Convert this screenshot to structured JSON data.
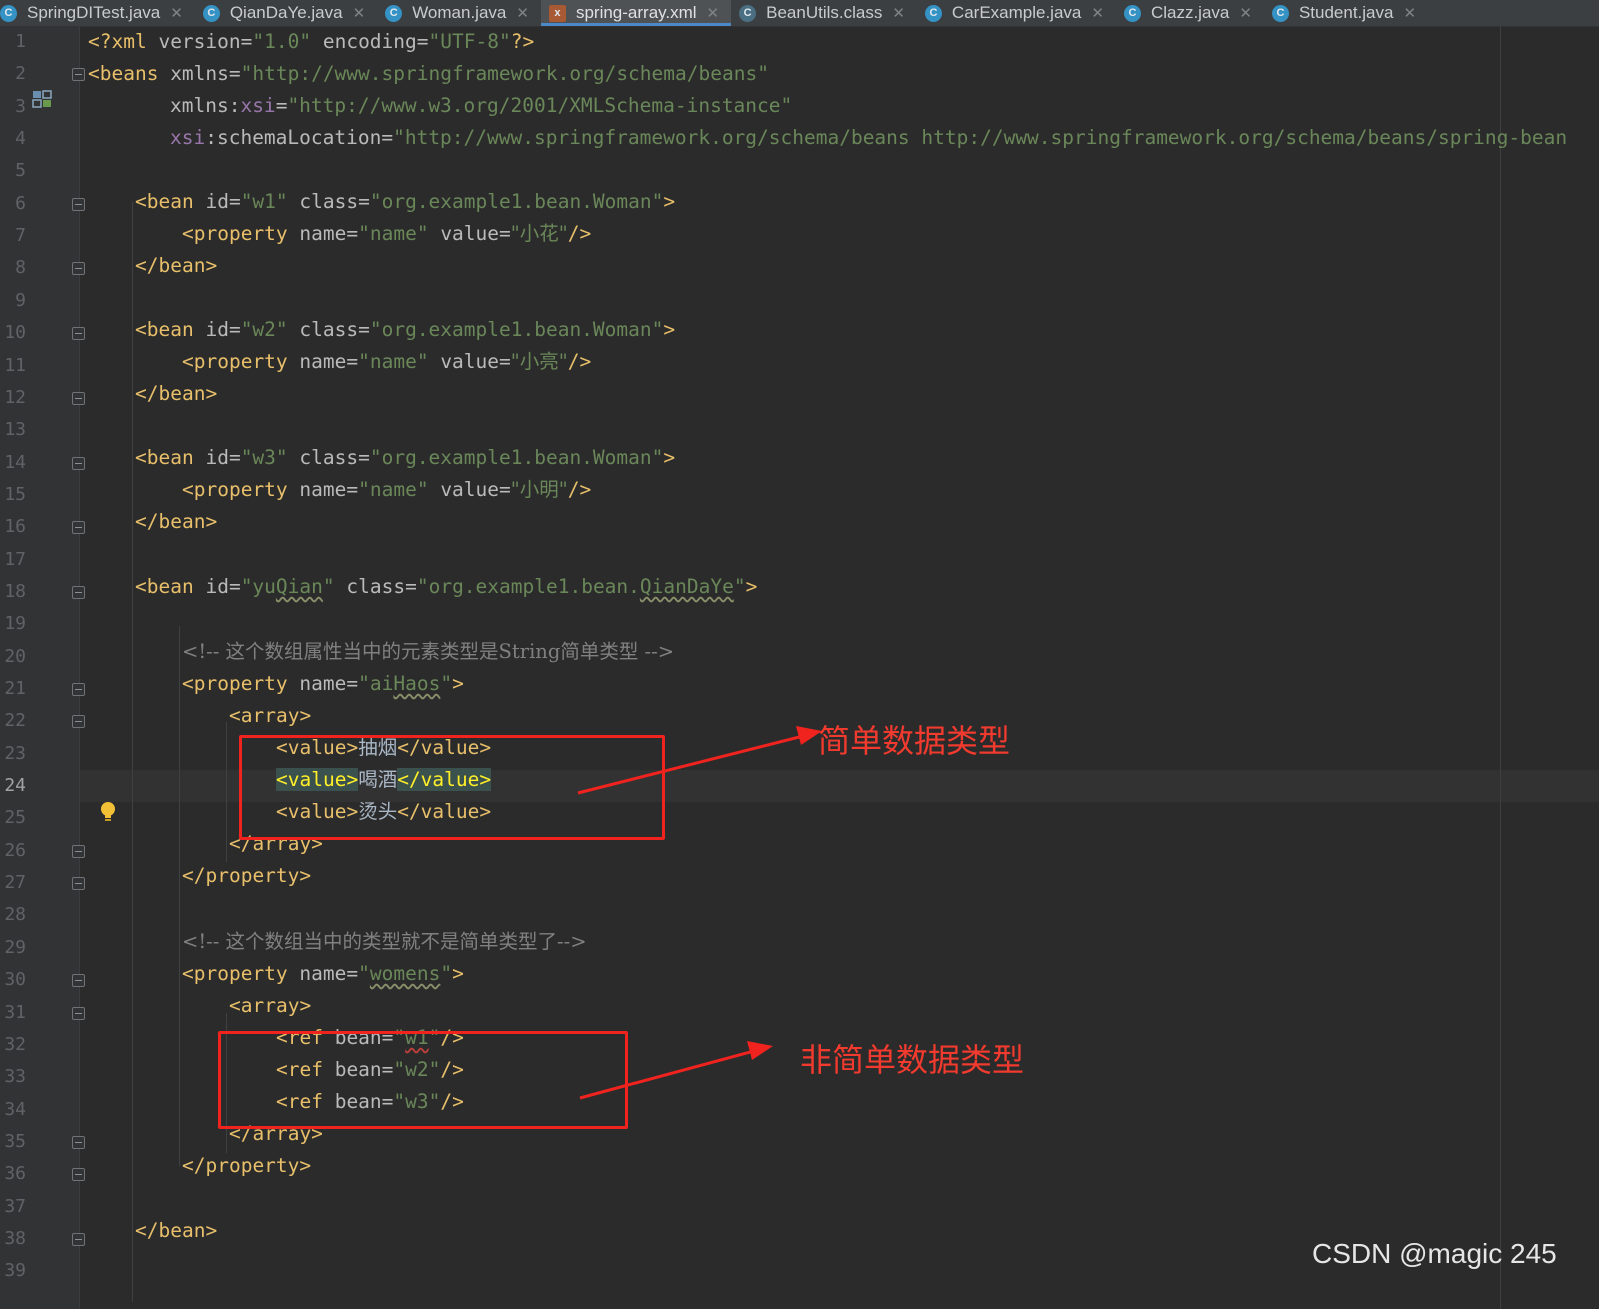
{
  "tabs": [
    {
      "label": "SpringDITest.java",
      "icon": "java-class-icon"
    },
    {
      "label": "QianDaYe.java",
      "icon": "java-class-icon"
    },
    {
      "label": "Woman.java",
      "icon": "java-class-icon"
    },
    {
      "label": "spring-array.xml",
      "icon": "xml-file-icon",
      "active": true
    },
    {
      "label": "BeanUtils.class",
      "icon": "compiled-class-icon"
    },
    {
      "label": "CarExample.java",
      "icon": "java-class-icon"
    },
    {
      "label": "Clazz.java",
      "icon": "java-class-icon"
    },
    {
      "label": "Student.java",
      "icon": "java-class-icon"
    }
  ],
  "editor": {
    "current_line": 24,
    "line_numbers": [
      "1",
      "2",
      "3",
      "4",
      "5",
      "6",
      "7",
      "8",
      "9",
      "10",
      "11",
      "12",
      "13",
      "14",
      "15",
      "16",
      "17",
      "18",
      "19",
      "20",
      "21",
      "22",
      "23",
      "24",
      "25",
      "26",
      "27",
      "28",
      "29",
      "30",
      "31",
      "32",
      "33",
      "34",
      "35",
      "36",
      "37",
      "38",
      "39"
    ],
    "code": {
      "l1": {
        "a": "<?xml ",
        "b": "version",
        "c": "=",
        "d": "\"1.0\"",
        "e": " ",
        "f": "encoding",
        "g": "=",
        "h": "\"UTF-8\"",
        "i": "?>"
      },
      "l2": {
        "a": "<beans ",
        "b": "xmlns",
        "c": "=",
        "d": "\"http://www.springframework.org/schema/beans\""
      },
      "l3": {
        "a": "xmlns:",
        "b": "xsi",
        "c": "=",
        "d": "\"http://www.w3.org/2001/XMLSchema-instance\""
      },
      "l4": {
        "a": "xsi",
        "b": ":schemaLocation",
        "c": "=",
        "d": "\"http://www.springframework.org/schema/beans http://www.springframework.org/schema/beans/spring-bean"
      },
      "l6": {
        "a": "<bean ",
        "b": "id",
        "c": "=",
        "d": "\"w1\"",
        "e": " class",
        "f": "=",
        "g": "\"org.example1.bean.Woman\"",
        "h": ">"
      },
      "l7": {
        "a": "<property ",
        "b": "name",
        "c": "=",
        "d": "\"name\"",
        "e": " value",
        "f": "=",
        "g": "\"小花\"",
        "h": "/>"
      },
      "l8": {
        "a": "</bean>"
      },
      "l10": {
        "a": "<bean ",
        "b": "id",
        "c": "=",
        "d": "\"w2\"",
        "e": " class",
        "f": "=",
        "g": "\"org.example1.bean.Woman\"",
        "h": ">"
      },
      "l11": {
        "a": "<property ",
        "b": "name",
        "c": "=",
        "d": "\"name\"",
        "e": " value",
        "f": "=",
        "g": "\"小亮\"",
        "h": "/>"
      },
      "l12": {
        "a": "</bean>"
      },
      "l14": {
        "a": "<bean ",
        "b": "id",
        "c": "=",
        "d": "\"w3\"",
        "e": " class",
        "f": "=",
        "g": "\"org.example1.bean.Woman\"",
        "h": ">"
      },
      "l15": {
        "a": "<property ",
        "b": "name",
        "c": "=",
        "d": "\"name\"",
        "e": " value",
        "f": "=",
        "g": "\"小明\"",
        "h": "/>"
      },
      "l16": {
        "a": "</bean>"
      },
      "l18": {
        "a": "<bean ",
        "b": "id",
        "c": "=",
        "d1": "\"yu",
        "d2": "Qian",
        "d3": "\"",
        "e": " class",
        "f": "=",
        "g1": "\"org.example1.bean.",
        "g2": "QianDaYe",
        "g3": "\"",
        "h": ">"
      },
      "l20": {
        "a": "<!-- 这个数组属性当中的元素类型是String简单类型 -->"
      },
      "l21": {
        "a": "<property ",
        "b": "name",
        "c": "=",
        "d1": "\"ai",
        "d2": "Haos",
        "d3": "\"",
        "h": ">"
      },
      "l22": {
        "a": "<array>"
      },
      "l23": {
        "a": "<value>",
        "b": "抽烟",
        "c": "</value>"
      },
      "l24": {
        "a": "<value>",
        "b": "喝酒",
        "c": "</value>"
      },
      "l25": {
        "a": "<value>",
        "b": "烫头",
        "c": "</value>"
      },
      "l26": {
        "a": "</array>"
      },
      "l27": {
        "a": "</property>"
      },
      "l29": {
        "a": "<!-- 这个数组当中的类型就不是简单类型了-->"
      },
      "l30": {
        "a": "<property ",
        "b": "name",
        "c": "=",
        "d1": "\"",
        "d2": "womens",
        "d3": "\"",
        "h": ">"
      },
      "l31": {
        "a": "<array>"
      },
      "l32": {
        "a": "<ref ",
        "b": "bean",
        "c": "=",
        "d1": "\"",
        "d2": "w1",
        "d3": "\"",
        "h": "/>"
      },
      "l33": {
        "a": "<ref ",
        "b": "bean",
        "c": "=",
        "d": "\"w2\"",
        "h": "/>"
      },
      "l34": {
        "a": "<ref ",
        "b": "bean",
        "c": "=",
        "d": "\"w3\"",
        "h": "/>"
      },
      "l35": {
        "a": "</array>"
      },
      "l36": {
        "a": "</property>"
      },
      "l38": {
        "a": "</bean>"
      }
    }
  },
  "annotations": {
    "simple_label": "简单数据类型",
    "non_simple_label": "非简单数据类型",
    "color": "#f0231f"
  },
  "watermark": "CSDN @magic 245",
  "colors": {
    "background": "#2b2b2b",
    "tag": "#e8bf6a",
    "string": "#6a8759",
    "attribute": "#bababa",
    "comment": "#808080",
    "namespace": "#9876aa"
  }
}
